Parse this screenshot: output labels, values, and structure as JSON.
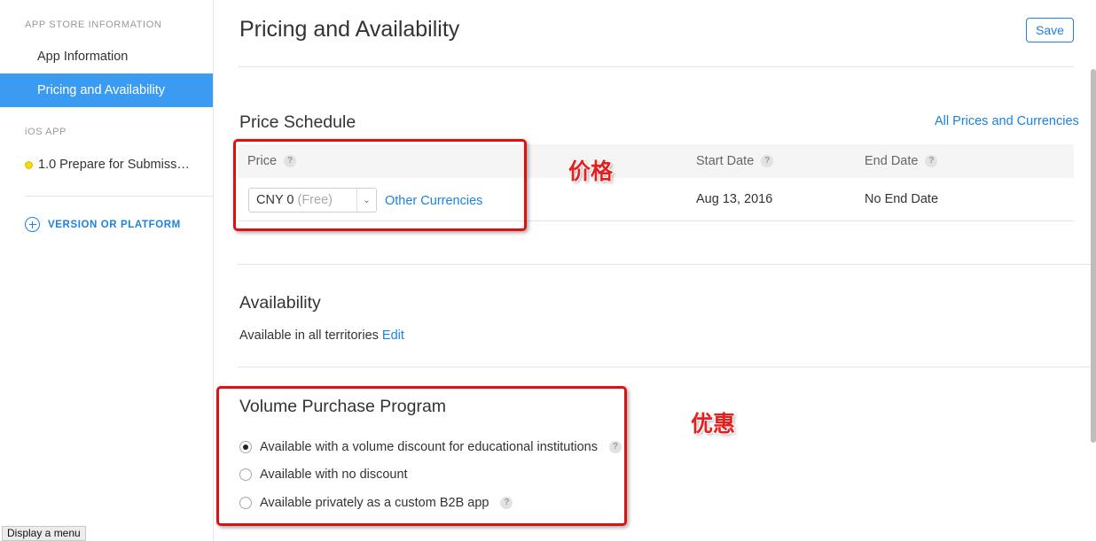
{
  "sidebar": {
    "section_app_store": "APP STORE INFORMATION",
    "items": [
      {
        "label": "App Information",
        "active": false
      },
      {
        "label": "Pricing and Availability",
        "active": true
      }
    ],
    "section_ios": "iOS APP",
    "version_label": "1.0 Prepare for Submiss…",
    "version_status_color": "#f5d90a",
    "add_version_label": "VERSION OR PLATFORM"
  },
  "header": {
    "title": "Pricing and Availability",
    "save_label": "Save"
  },
  "price_schedule": {
    "title": "Price Schedule",
    "all_prices_link": "All Prices and Currencies",
    "columns": [
      "Price",
      "Start Date",
      "End Date"
    ],
    "price_value": "CNY 0",
    "price_note": "(Free)",
    "other_currencies_link": "Other Currencies",
    "start_date": "Aug 13, 2016",
    "end_date": "No End Date"
  },
  "availability": {
    "title": "Availability",
    "text": "Available in all territories",
    "edit_link": "Edit"
  },
  "vpp": {
    "title": "Volume Purchase Program",
    "options": [
      {
        "label": "Available with a volume discount for educational institutions",
        "checked": true,
        "help": true
      },
      {
        "label": "Available with no discount",
        "checked": false,
        "help": false
      },
      {
        "label": "Available privately as a custom B2B app",
        "checked": false,
        "help": true
      }
    ]
  },
  "annotations": {
    "price_label": "价格",
    "discount_label": "优惠"
  },
  "tooltip": "Display a menu",
  "help_glyph": "?",
  "colors": {
    "accent": "#1a82e2",
    "sidebar_active": "#3a9bf0",
    "annotation_red": "#e01010"
  }
}
